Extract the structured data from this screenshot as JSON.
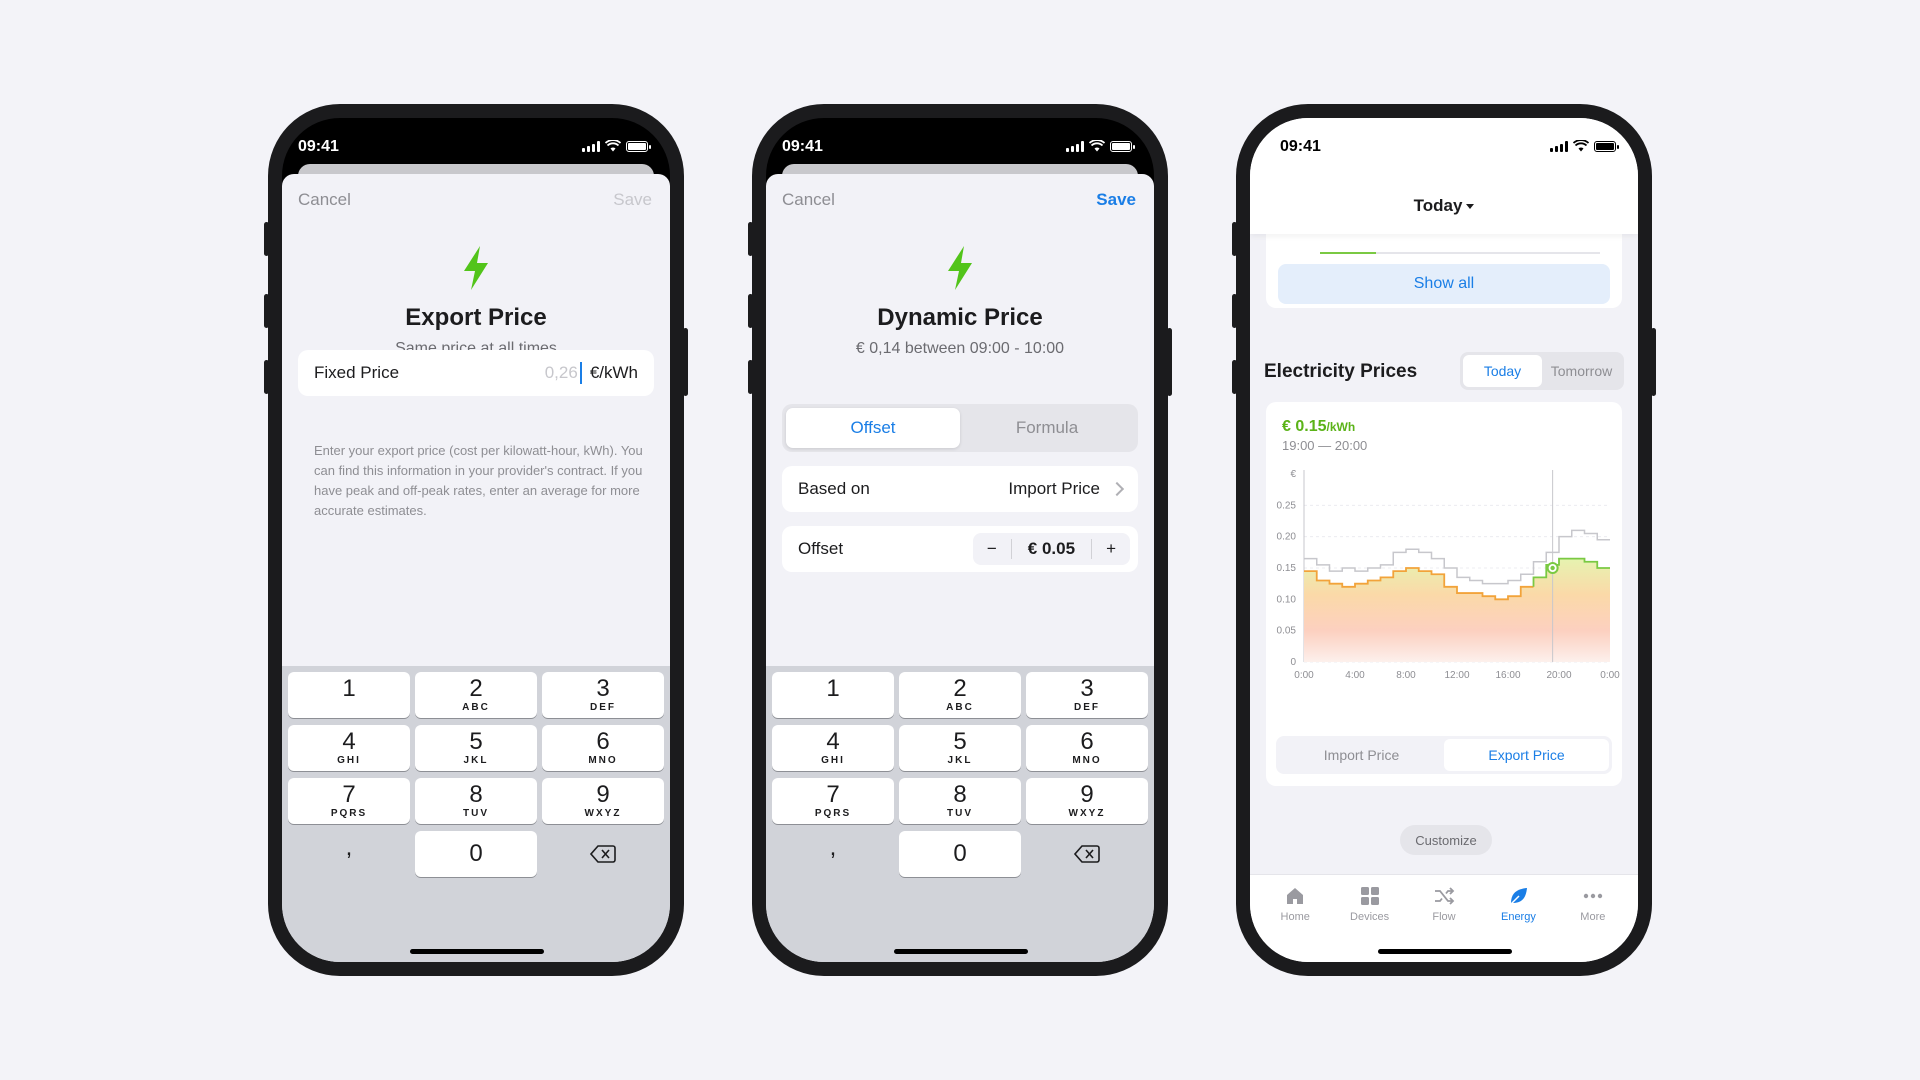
{
  "status_time": "09:41",
  "screen1": {
    "cancel": "Cancel",
    "save": "Save",
    "title": "Export Price",
    "subtitle": "Same price at all times",
    "field_label": "Fixed Price",
    "field_placeholder": "0,26",
    "unit": "€/kWh",
    "help": "Enter your export price (cost per kilowatt-hour, kWh). You can find this information in your provider's contract. If you have peak and off-peak rates, enter an average for more accurate estimates."
  },
  "screen2": {
    "cancel": "Cancel",
    "save": "Save",
    "title": "Dynamic Price",
    "subtitle": "€ 0,14 between 09:00 - 10:00",
    "seg_offset": "Offset",
    "seg_formula": "Formula",
    "based_on_label": "Based on",
    "based_on_value": "Import Price",
    "offset_label": "Offset",
    "minus": "−",
    "offset_value": "€ 0.05",
    "plus": "+"
  },
  "keypad": {
    "keys": [
      {
        "n": "1",
        "l": ""
      },
      {
        "n": "2",
        "l": "ABC"
      },
      {
        "n": "3",
        "l": "DEF"
      },
      {
        "n": "4",
        "l": "GHI"
      },
      {
        "n": "5",
        "l": "JKL"
      },
      {
        "n": "6",
        "l": "MNO"
      },
      {
        "n": "7",
        "l": "PQRS"
      },
      {
        "n": "8",
        "l": "TUV"
      },
      {
        "n": "9",
        "l": "WXYZ"
      }
    ],
    "comma": ",",
    "zero": "0"
  },
  "screen3": {
    "header_title": "Today",
    "show_all": "Show all",
    "section_title": "Electricity Prices",
    "seg_today": "Today",
    "seg_tomorrow": "Tomorrow",
    "price_value": "€ 0.15",
    "price_unit": "/kWh",
    "price_time": "19:00 — 20:00",
    "progress": 0.2,
    "seg_import": "Import Price",
    "seg_export": "Export Price",
    "customize": "Customize",
    "tabs": [
      "Home",
      "Devices",
      "Flow",
      "Energy",
      "More"
    ]
  },
  "chart_data": {
    "type": "line",
    "ylabel": "€",
    "ylim": [
      0,
      0.3
    ],
    "yticks": [
      "0",
      "0.05",
      "0.10",
      "0.15",
      "0.20",
      "0.25"
    ],
    "xticks": [
      "0:00",
      "4:00",
      "8:00",
      "12:00",
      "16:00",
      "20:00",
      "0:00"
    ],
    "x": [
      0,
      1,
      2,
      3,
      4,
      5,
      6,
      7,
      8,
      9,
      10,
      11,
      12,
      13,
      14,
      15,
      16,
      17,
      18,
      19,
      20,
      21,
      22,
      23
    ],
    "series": [
      {
        "name": "Import Price",
        "values": [
          0.165,
          0.155,
          0.145,
          0.15,
          0.145,
          0.15,
          0.155,
          0.175,
          0.18,
          0.175,
          0.165,
          0.15,
          0.135,
          0.13,
          0.125,
          0.125,
          0.13,
          0.14,
          0.16,
          0.175,
          0.2,
          0.21,
          0.205,
          0.195
        ]
      },
      {
        "name": "Export Price",
        "values": [
          0.145,
          0.13,
          0.125,
          0.12,
          0.125,
          0.13,
          0.135,
          0.145,
          0.15,
          0.145,
          0.14,
          0.12,
          0.11,
          0.11,
          0.105,
          0.1,
          0.105,
          0.12,
          0.135,
          0.155,
          0.165,
          0.165,
          0.16,
          0.15
        ]
      }
    ],
    "marker_x": 19.5,
    "marker_value": 0.15,
    "colors": {
      "import": "#c7c7cc",
      "export": "#7ac943",
      "accent": "#1a7ee6"
    }
  }
}
